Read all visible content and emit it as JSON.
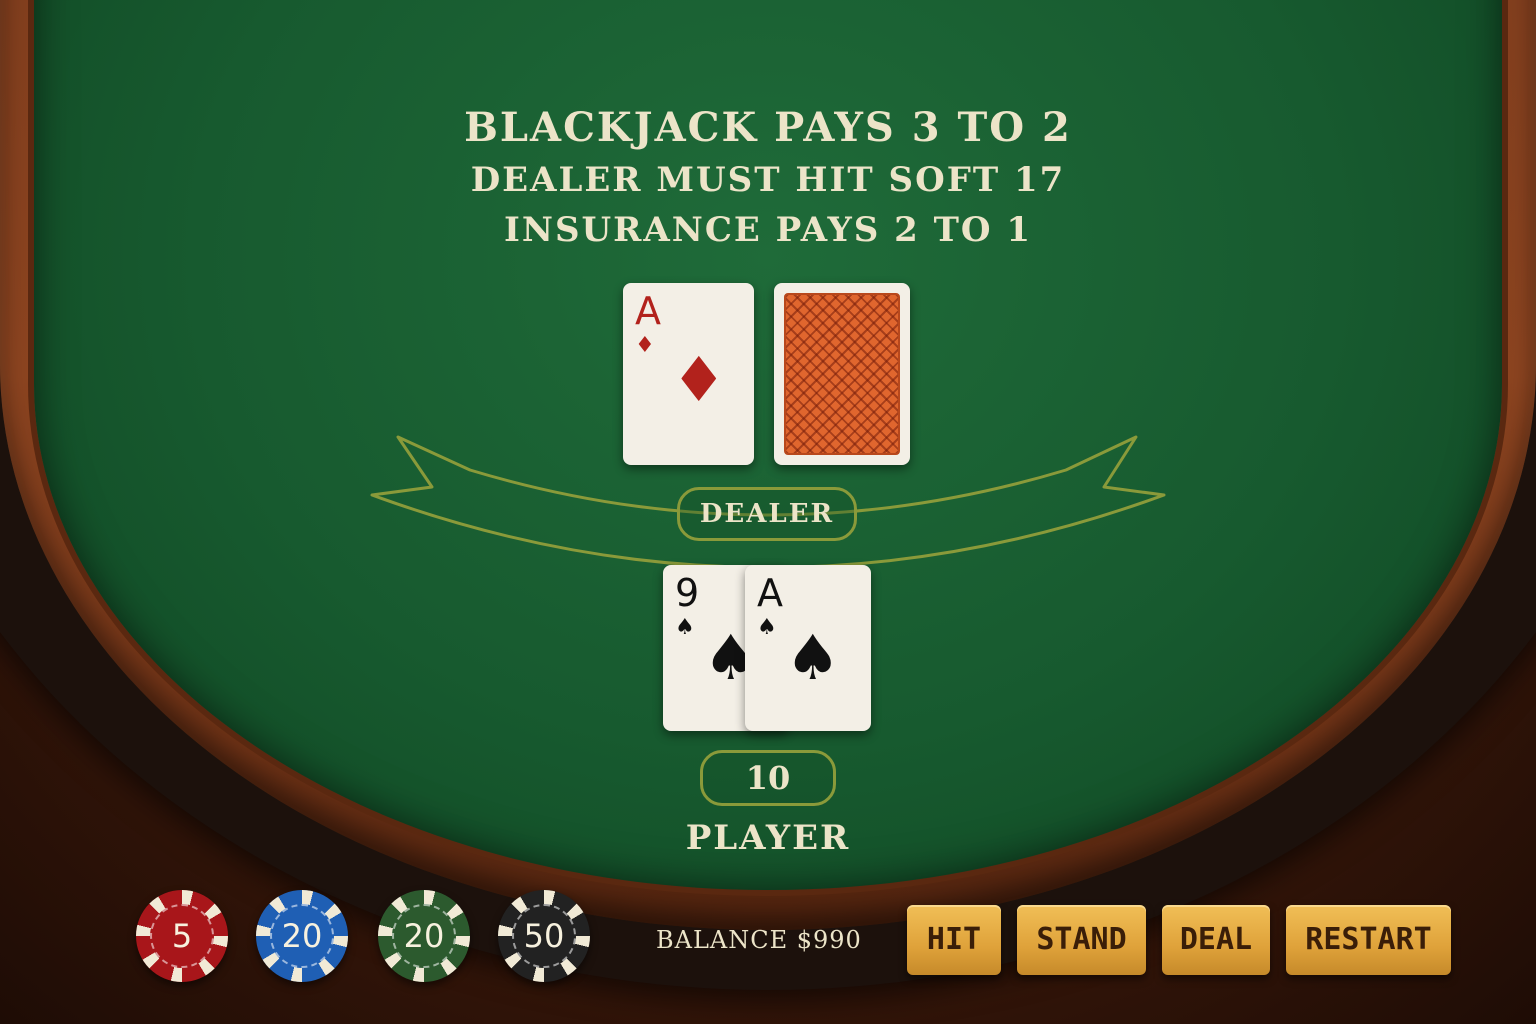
{
  "rules": {
    "line1": "BLACKJACK PAYS 3 TO 2",
    "line2": "DEALER MUST HIT SOFT 17",
    "line3": "INSURANCE PAYS 2 TO 1"
  },
  "dealer": {
    "label": "DEALER",
    "cards": [
      {
        "rank": "A",
        "suit": "♦",
        "suit_name": "diamonds",
        "color": "#b2221c",
        "face_up": true
      },
      {
        "face_up": false,
        "back_color": "#e0662e"
      }
    ]
  },
  "player": {
    "label": "PLAYER",
    "score": "10",
    "cards": [
      {
        "rank": "9",
        "suit": "♠",
        "suit_name": "spades",
        "color": "#111111"
      },
      {
        "rank": "A",
        "suit": "♠",
        "suit_name": "spades",
        "color": "#111111"
      }
    ]
  },
  "chips": [
    {
      "value": "5",
      "color": "#a8161a"
    },
    {
      "value": "20",
      "color": "#1f5fb4"
    },
    {
      "value": "20",
      "color": "#2c5a2e"
    },
    {
      "value": "50",
      "color": "#222222"
    }
  ],
  "balance": "BALANCE $990",
  "buttons": {
    "hit": "HIT",
    "stand": "STAND",
    "deal": "DEAL",
    "restart": "RESTART"
  },
  "colors": {
    "felt": "#1a6234",
    "rail": "#7a3a1c",
    "button": "#e2a63e",
    "text": "#ece4c8",
    "line": "#8a9a3a"
  }
}
